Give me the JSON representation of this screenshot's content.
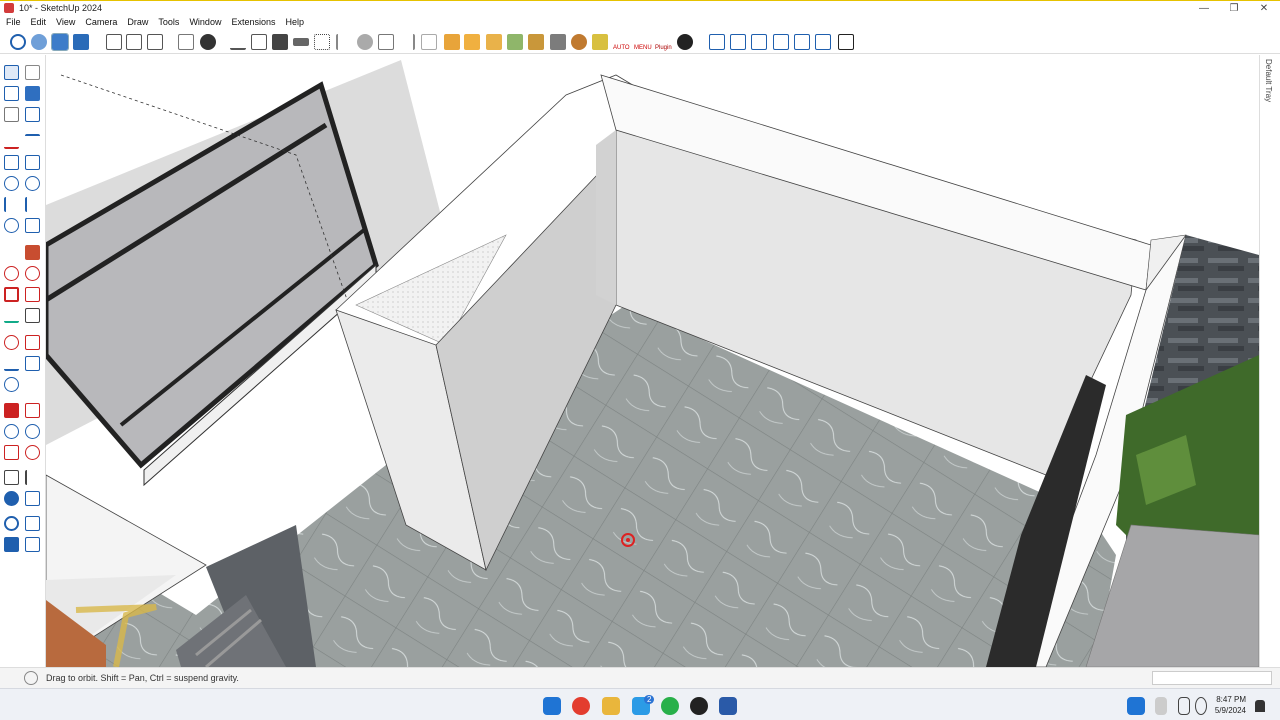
{
  "window": {
    "title": "10* - SketchUp 2024",
    "minimize": "—",
    "maximize": "❐",
    "close": "✕"
  },
  "menu": [
    "File",
    "Edit",
    "View",
    "Camera",
    "Draw",
    "Tools",
    "Window",
    "Extensions",
    "Help"
  ],
  "toolbar": {
    "icons": [
      "orbit-icon",
      "pan-icon",
      "zoom-icon",
      "zoom-extents-icon",
      "select-icon",
      "eraser-icon",
      "paint-icon",
      "style-icon",
      "line-icon",
      "pushpull-icon",
      "camera-icon",
      "section-icon",
      "grid-icon",
      "push-icon",
      "sphere-icon",
      "tape-icon",
      "hook-icon",
      "dimension-icon",
      "text-icon",
      "axes-icon",
      "folder-icon",
      "building-icon",
      "components-icon",
      "plugin-icon",
      "wand-icon",
      "auto-icon",
      "menu-icon",
      "plugin2-icon",
      "plus-icon",
      "help-icon",
      "iso-icon",
      "front-icon",
      "right-icon",
      "back-icon",
      "left-icon",
      "top-icon"
    ],
    "labels": {
      "auto": "AUTO",
      "menu": "MENU",
      "plugin": "Plugin"
    }
  },
  "left_tools": [
    "select",
    "orbit",
    "paint",
    "eraser",
    "tape",
    "protractor",
    "pencil",
    "arc",
    "rectangle",
    "rotated-rect",
    "circle",
    "polygon",
    "line",
    "freehand",
    "arc2",
    "pie",
    "move",
    "pushpull",
    "rotate",
    "follow",
    "scale",
    "offset",
    "axes",
    "tape2",
    "pan",
    "text",
    "walk",
    "zoom",
    "section",
    "lookaround",
    "position",
    "zoom-ext",
    "lines",
    "3dtext",
    "people",
    "warehouse",
    "sandbox",
    "layer"
  ],
  "tray": {
    "label": "Default Tray"
  },
  "status": {
    "text": "Drag to orbit. Shift = Pan, Ctrl = suspend gravity."
  },
  "taskbar": {
    "time": "8:47 PM",
    "date": "5/9/2024",
    "badge": "2"
  }
}
